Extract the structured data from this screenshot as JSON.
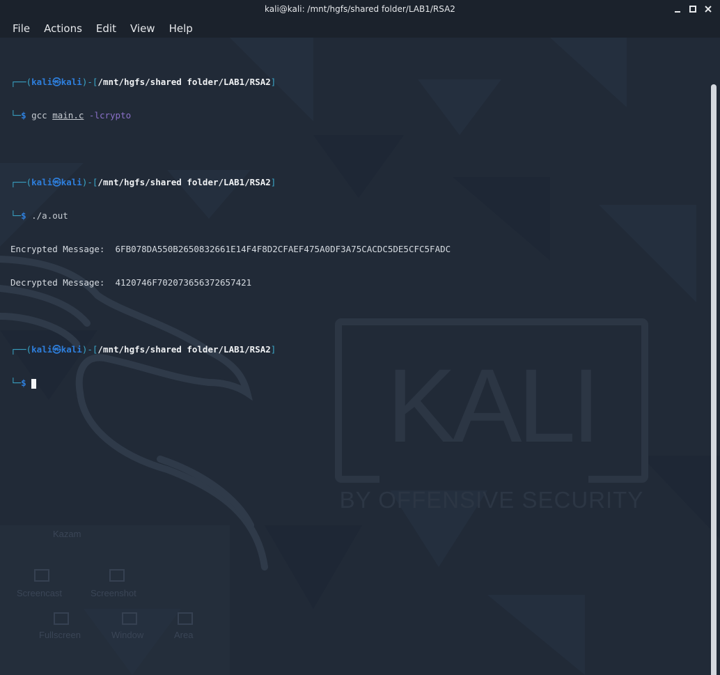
{
  "window": {
    "title": "kali@kali: /mnt/hgfs/shared folder/LAB1/RSA2",
    "controls": [
      "minimize-icon",
      "maximize-icon",
      "close-icon"
    ]
  },
  "menu": {
    "items": [
      "File",
      "Actions",
      "Edit",
      "View",
      "Help"
    ]
  },
  "terminal": {
    "prompt_user": "kali",
    "prompt_at": "㉿",
    "prompt_host": "kali",
    "cwd": "/mnt/hgfs/shared folder/LAB1/RSA2",
    "cmd1": {
      "bin": "gcc",
      "file": "main.c",
      "flag": "-lcrypto"
    },
    "cmd2": "./a.out",
    "output": [
      "Encrypted Message:  6FB078DA550B2650832661E14F4F8D2CFAEF475A0DF3A75CACDC5DE5CFC5FADC",
      "Decrypted Message:  4120746F702073656372657421"
    ]
  },
  "background": {
    "logo_text": "KALI",
    "tagline": "BY OFFENSIVE SECURITY",
    "ghost_labels": [
      "Kazam",
      "Screencast",
      "Screenshot",
      "Window",
      "Area",
      "Fullscreen"
    ]
  },
  "colors": {
    "accent": "#2e7fdd",
    "background": "#212a37",
    "titlebar": "#1b222c"
  }
}
